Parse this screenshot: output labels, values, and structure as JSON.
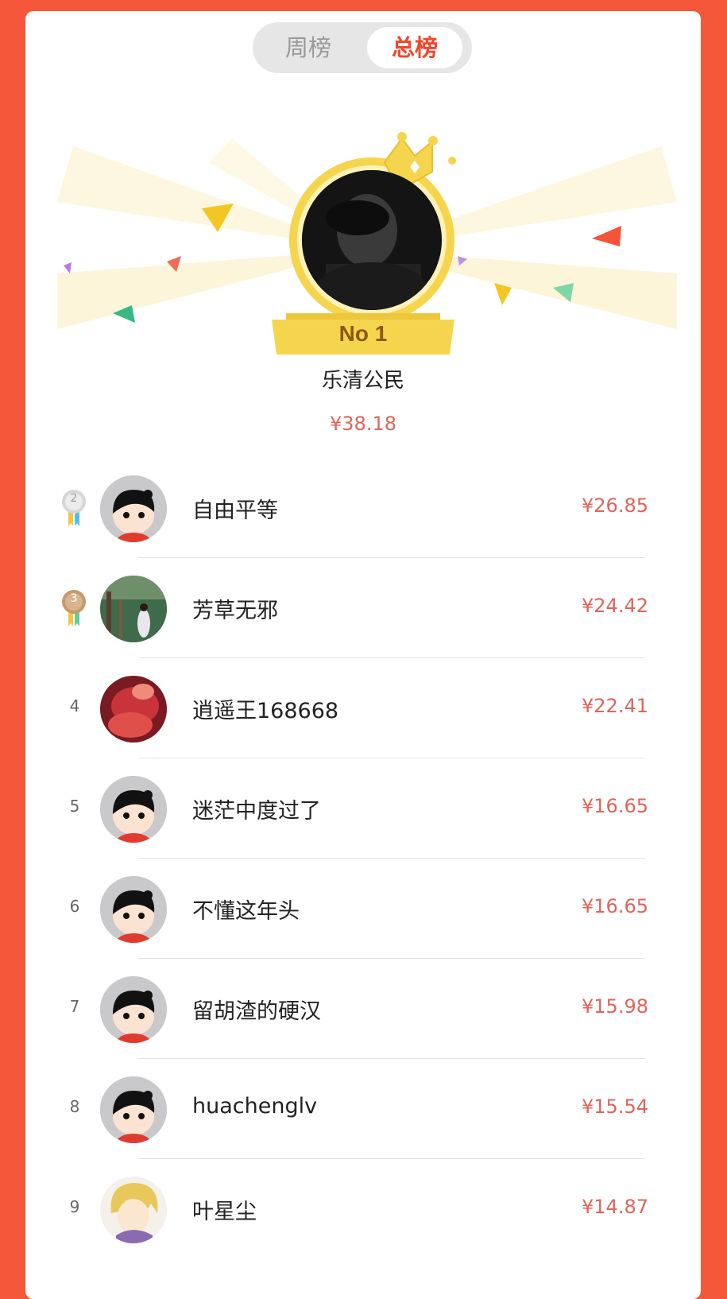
{
  "tabs": [
    {
      "label": "周榜",
      "active": false
    },
    {
      "label": "总榜",
      "active": true
    }
  ],
  "champion": {
    "badge": "No 1",
    "name": "乐清公民",
    "amount": "¥38.18"
  },
  "leaderboard": [
    {
      "rank": "2",
      "rank_style": "silver-medal",
      "name": "自由平等",
      "amount": "¥26.85",
      "avatar": "default-cartoon-avatar"
    },
    {
      "rank": "3",
      "rank_style": "bronze-medal",
      "name": "芳草无邪",
      "amount": "¥24.42",
      "avatar": "photo-garden-avatar"
    },
    {
      "rank": "4",
      "rank_style": "number",
      "name": "逍遥王168668",
      "amount": "¥22.41",
      "avatar": "photo-red-avatar"
    },
    {
      "rank": "5",
      "rank_style": "number",
      "name": "迷茫中度过了",
      "amount": "¥16.65",
      "avatar": "default-cartoon-avatar"
    },
    {
      "rank": "6",
      "rank_style": "number",
      "name": "不懂这年头",
      "amount": "¥16.65",
      "avatar": "default-cartoon-avatar"
    },
    {
      "rank": "7",
      "rank_style": "number",
      "name": "留胡渣的硬汉",
      "amount": "¥15.98",
      "avatar": "default-cartoon-avatar"
    },
    {
      "rank": "8",
      "rank_style": "number",
      "name": "huachenglv",
      "amount": "¥15.54",
      "avatar": "default-cartoon-avatar"
    },
    {
      "rank": "9",
      "rank_style": "number",
      "name": "叶星尘",
      "amount": "¥14.87",
      "avatar": "anime-blond-avatar"
    }
  ],
  "colors": {
    "background": "#f5573a",
    "accent": "#f0472c",
    "amount": "#e0645a",
    "gold": "#f3d34a"
  }
}
